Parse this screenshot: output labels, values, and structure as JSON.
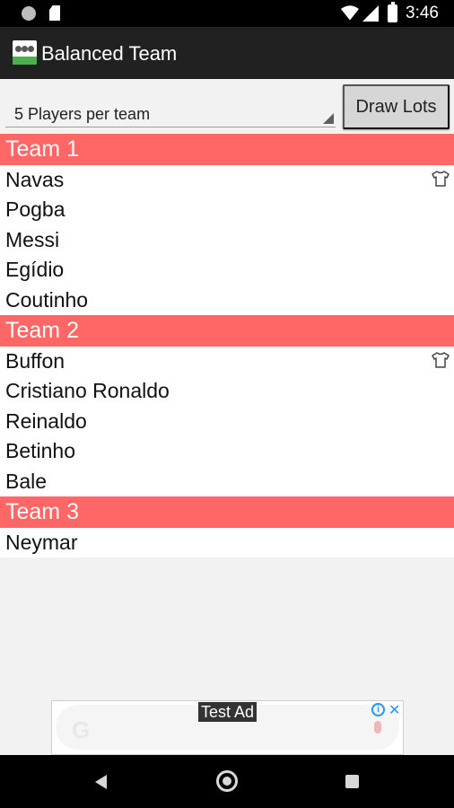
{
  "status_bar": {
    "time": "3:46",
    "icons": [
      "notification-dot-icon",
      "sd-card-icon",
      "wifi-icon",
      "cell-signal-icon",
      "battery-charging-icon"
    ]
  },
  "app_bar": {
    "title": "Balanced Team",
    "logo_icon": "team-logo-icon"
  },
  "controls": {
    "players_per_team": "5 Players per team",
    "draw_button": "Draw Lots"
  },
  "teams": [
    {
      "name": "Team 1",
      "players": [
        {
          "name": "Navas",
          "goalkeeper": true
        },
        {
          "name": "Pogba",
          "goalkeeper": false
        },
        {
          "name": "Messi",
          "goalkeeper": false
        },
        {
          "name": "Egídio",
          "goalkeeper": false
        },
        {
          "name": "Coutinho",
          "goalkeeper": false
        }
      ]
    },
    {
      "name": "Team 2",
      "players": [
        {
          "name": "Buffon",
          "goalkeeper": true
        },
        {
          "name": "Cristiano Ronaldo",
          "goalkeeper": false
        },
        {
          "name": "Reinaldo",
          "goalkeeper": false
        },
        {
          "name": "Betinho",
          "goalkeeper": false
        },
        {
          "name": "Bale",
          "goalkeeper": false
        }
      ]
    },
    {
      "name": "Team 3",
      "players": [
        {
          "name": "Neymar",
          "goalkeeper": false
        }
      ]
    }
  ],
  "ad": {
    "label": "Test Ad",
    "info_icon": "ad-info-icon",
    "close_icon": "ad-close-icon"
  },
  "nav_bar": {
    "icons": [
      "back-icon",
      "home-icon",
      "recents-icon"
    ]
  },
  "colors": {
    "team_header": "#ff6666",
    "app_bar": "#212121",
    "status_bar": "#000000"
  }
}
